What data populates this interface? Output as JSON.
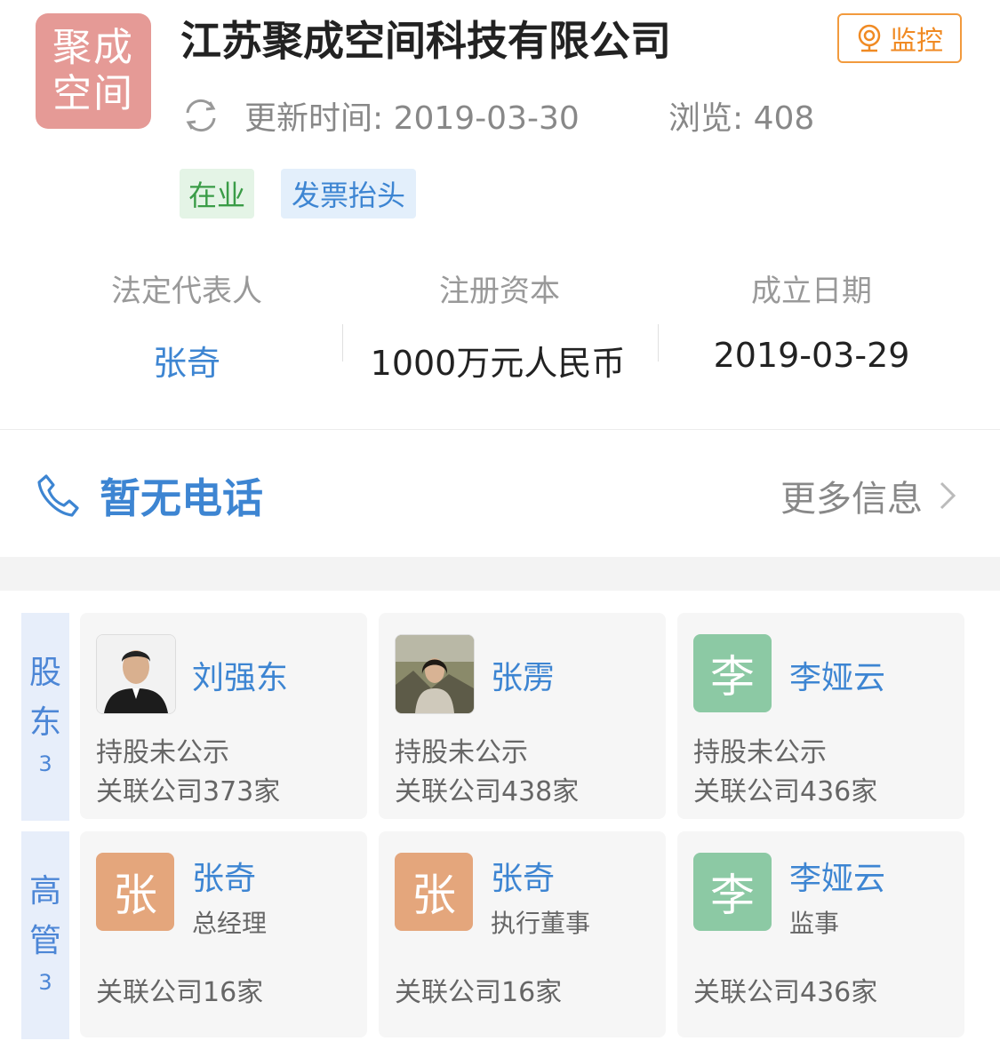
{
  "company": {
    "logo_line1": "聚成",
    "logo_line2": "空间",
    "name": "江苏聚成空间科技有限公司",
    "monitor_label": "监控",
    "update_time": "更新时间: 2019-03-30",
    "views": "浏览: 408",
    "status_tag": "在业",
    "invoice_tag": "发票抬头"
  },
  "info": [
    {
      "label": "法定代表人",
      "value": "张奇"
    },
    {
      "label": "注册资本",
      "value": "1000万元人民币"
    },
    {
      "label": "成立日期",
      "value": "2019-03-29"
    }
  ],
  "contact": {
    "phone_text": "暂无电话",
    "more_info": "更多信息"
  },
  "shareholders": {
    "label_chars": [
      "股",
      "东"
    ],
    "count": "3",
    "cards": [
      {
        "name": "刘强东",
        "avatar_type": "photo-man",
        "line1": "持股未公示",
        "line2": "关联公司373家"
      },
      {
        "name": "张雳",
        "avatar_type": "photo-woman",
        "line1": "持股未公示",
        "line2": "关联公司438家"
      },
      {
        "name": "李娅云",
        "avatar_char": "李",
        "avatar_color": "#8cc9a4",
        "line1": "持股未公示",
        "line2": "关联公司436家"
      }
    ]
  },
  "executives": {
    "label_chars": [
      "高",
      "管"
    ],
    "count": "3",
    "cards": [
      {
        "name": "张奇",
        "avatar_char": "张",
        "avatar_color": "#e4a67c",
        "role": "总经理",
        "line": "关联公司16家"
      },
      {
        "name": "张奇",
        "avatar_char": "张",
        "avatar_color": "#e4a67c",
        "role": "执行董事",
        "line": "关联公司16家"
      },
      {
        "name": "李娅云",
        "avatar_char": "李",
        "avatar_color": "#8cc9a4",
        "role": "监事",
        "line": "关联公司436家"
      }
    ]
  },
  "colors": {
    "link_blue": "#3d85d2",
    "accent_orange": "#f08a23",
    "status_green": "#3a9c47",
    "logo_bg": "#e59a96"
  }
}
